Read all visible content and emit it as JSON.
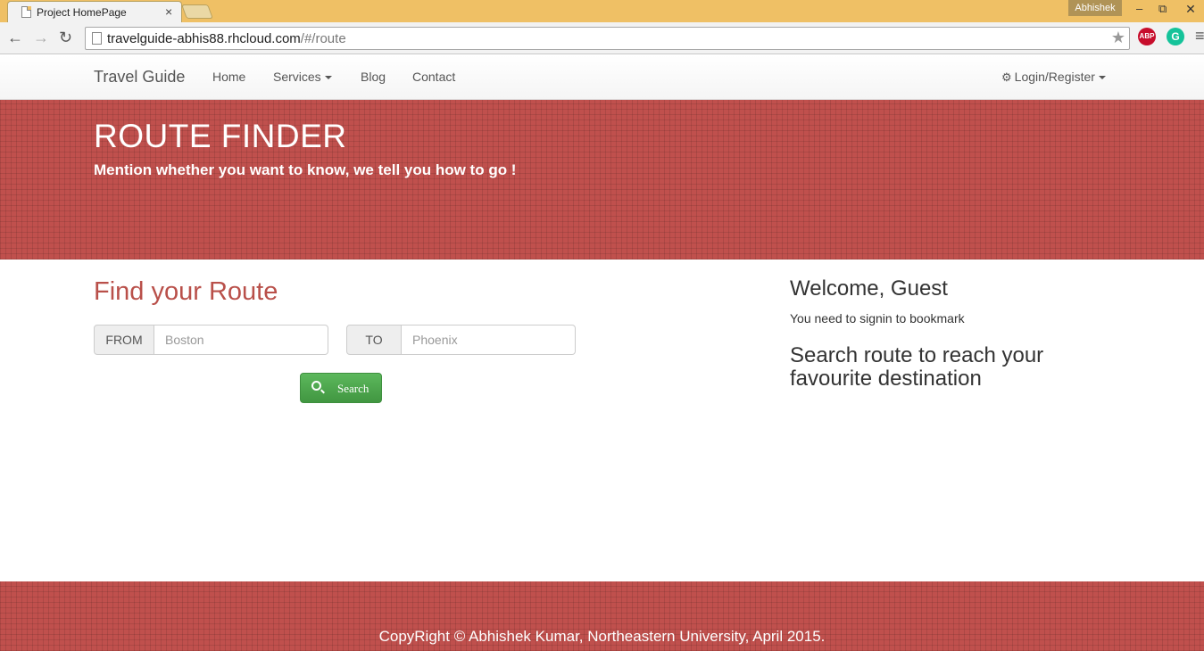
{
  "browser": {
    "tab_title": "Project HomePage",
    "tab_close": "×",
    "profile_name": "Abhishek",
    "url_host": "travelguide-abhis88.rhcloud.com",
    "url_path": "/#/route",
    "extensions": [
      "ABP",
      "G"
    ]
  },
  "navbar": {
    "brand": "Travel Guide",
    "links": [
      "Home",
      "Services",
      "Blog",
      "Contact"
    ],
    "login": "Login/Register"
  },
  "hero": {
    "title": "ROUTE FINDER",
    "subtitle": "Mention whether you want to know, we tell you how to go !"
  },
  "finder": {
    "title": "Find your Route",
    "from_label": "FROM",
    "from_placeholder": "Boston",
    "to_label": "TO",
    "to_placeholder": "Phoenix",
    "search_label": "Search"
  },
  "sidebar": {
    "welcome": "Welcome, Guest",
    "signin_msg": "You need to signin to bookmark",
    "cta": "Search route to reach your favourite destination"
  },
  "footer": {
    "copyright": "CopyRight © Abhishek Kumar, Northeastern University, April 2015."
  },
  "colors": {
    "accent_red": "#c0504d",
    "title_red": "#b9504a",
    "success_green": "#5cb85c",
    "chrome_titlebar": "#efc065"
  }
}
